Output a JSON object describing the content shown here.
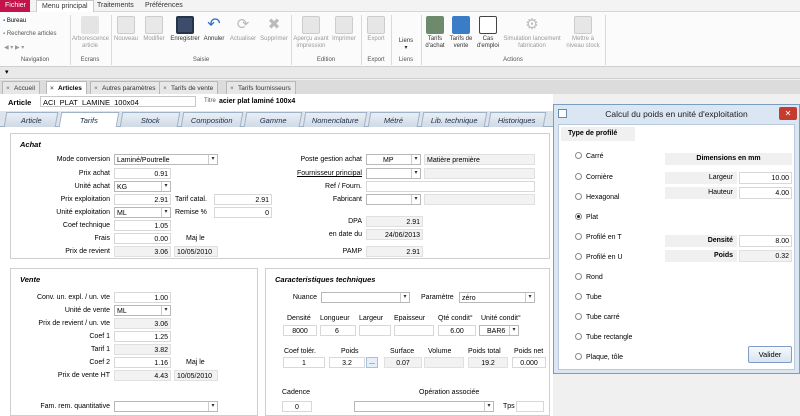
{
  "menu": {
    "file": "Fichier",
    "tabs": [
      "Menu principal",
      "Traitements",
      "Préférences"
    ]
  },
  "ribbon": {
    "nav": {
      "bureau": "Bureau",
      "recherche": "Recherche articles",
      "label": "Navigation"
    },
    "ecrans": {
      "arbo": "Arborescence article",
      "label": "Ecrans"
    },
    "saisie": {
      "nouveau": "Nouveau",
      "modifier": "Modifier",
      "enregistrer": "Enregistrer",
      "annuler": "Annuler",
      "actualiser": "Actualiser",
      "supprimer": "Supprimer",
      "label": "Saisie"
    },
    "edition": {
      "apercu": "Aperçu avant impression",
      "imprimer": "Imprimer",
      "label": "Edition"
    },
    "export": {
      "export": "Export",
      "label": "Export"
    },
    "liens": {
      "liens": "Liens",
      "label": "Liens"
    },
    "actions": {
      "tarifs_achat": "Tarifs d'achat",
      "tarifs_vente": "Tarifs de vente",
      "cas_emploi": "Cas d'emploi",
      "simulation": "Simulation lancement fabrication",
      "nouveau_stock": "Mettre à niveau stock",
      "label": "Actions"
    }
  },
  "doc_tabs": [
    "Accueil",
    "Articles",
    "Autres paramètres",
    "Tarifs de vente",
    "Tarifs fournisseurs"
  ],
  "article": {
    "label": "Article",
    "code": "ACI_PLAT_LAMINE_100x04",
    "titre_label": "Titre",
    "titre": "acier plat laminé 100x4"
  },
  "page_tabs": [
    "Article",
    "Tarifs",
    "Stock",
    "Composition",
    "Gamme",
    "Nomenclature",
    "Métré",
    "Lib. technique",
    "Historiques"
  ],
  "achat": {
    "title": "Achat",
    "mode_conversion": {
      "label": "Mode conversion",
      "value": "Laminé/Poutrelle"
    },
    "prix_achat": {
      "label": "Prix achat",
      "value": "0.91"
    },
    "unite_achat": {
      "label": "Unité achat",
      "value": "KG"
    },
    "prix_exploitation": {
      "label": "Prix exploitation",
      "value": "2.91"
    },
    "tarif_catal": {
      "label": "Tarif catal.",
      "value": "2.91"
    },
    "unite_exploitation": {
      "label": "Unité exploitation",
      "value": "ML"
    },
    "remise": {
      "label": "Remise %",
      "value": "0"
    },
    "coef_technique": {
      "label": "Coef technique",
      "value": "1.05"
    },
    "frais": {
      "label": "Frais",
      "value": "0.00",
      "maj": "Maj le"
    },
    "prix_revient": {
      "label": "Prix de revient",
      "value": "3.06",
      "date": "10/05/2010"
    },
    "poste_gestion": {
      "label": "Poste gestion achat",
      "value": "MP",
      "desc": "Matière première"
    },
    "fournisseur": {
      "label": "Fournisseur principal"
    },
    "ref_fourn": {
      "label": "Ref / Fourn."
    },
    "fabricant": {
      "label": "Fabricant"
    },
    "dpa": {
      "label": "DPA",
      "value": "2.91"
    },
    "en_date_du": {
      "label": "en date du",
      "value": "24/06/2013"
    },
    "pamp": {
      "label": "PAMP",
      "value": "2.91"
    }
  },
  "vente": {
    "title": "Vente",
    "conv": {
      "label": "Conv. un. expl. / un. vte",
      "value": "1.00"
    },
    "unite_vente": {
      "label": "Unité de vente",
      "value": "ML"
    },
    "prix_rev_vte": {
      "label": "Prix de revient / un. vte",
      "value": "3.06"
    },
    "coef1": {
      "label": "Coef 1",
      "value": "1.25"
    },
    "tarif1": {
      "label": "Tarif 1",
      "value": "3.82"
    },
    "coef2": {
      "label": "Coef 2",
      "value": "1.16",
      "maj": "Maj le"
    },
    "prix_vente_ht": {
      "label": "Prix de vente HT",
      "value": "4.43",
      "date": "10/05/2010"
    },
    "fam_rem": {
      "label": "Fam. rem. quantitative"
    }
  },
  "carac": {
    "title": "Caracteristiques techniques",
    "nuance": {
      "label": "Nuance"
    },
    "parametre": {
      "label": "Paramètre",
      "value": "zéro"
    },
    "headers1": [
      "Densité",
      "Longueur",
      "Largeur",
      "Epaisseur",
      "Qté condit°",
      "Unité condit°"
    ],
    "values1": [
      "8000",
      "6",
      "",
      "",
      "6.00",
      "BAR6"
    ],
    "headers2": [
      "Coef tolér.",
      "Poids",
      "Surface",
      "Volume",
      "Poids total",
      "Poids net"
    ],
    "values2": [
      "1",
      "3.2",
      "0.07",
      "",
      "19.2",
      "0.000"
    ],
    "more": "...",
    "cadence": {
      "label": "Cadence",
      "value": "0"
    },
    "operation": {
      "label": "Opération associée"
    },
    "tps": {
      "label": "Tps"
    }
  },
  "dialog": {
    "title": "Calcul du poids en unité d'exploitation",
    "close": "✕",
    "type_label": "Type de profilé",
    "profiles": [
      "Carré",
      "Cornière",
      "Hexagonal",
      "Plat",
      "Profilé en T",
      "Profilé en U",
      "Rond",
      "Tube",
      "Tube carré",
      "Tube rectangle",
      "Plaque, tôle"
    ],
    "selected": "Plat",
    "dims_label": "Dimensions en mm",
    "largeur": {
      "label": "Largeur",
      "value": "10.00"
    },
    "hauteur": {
      "label": "Hauteur",
      "value": "4.00"
    },
    "densite": {
      "label": "Densité",
      "value": "8.00"
    },
    "poids": {
      "label": "Poids",
      "value": "0.32"
    },
    "valider": "Valider"
  },
  "colors": {
    "file_tab": "#c4124b",
    "close_btn": "#c73b2e",
    "dialog_bg": "#dbe6f3",
    "tab_bg": "#dde4ec"
  }
}
